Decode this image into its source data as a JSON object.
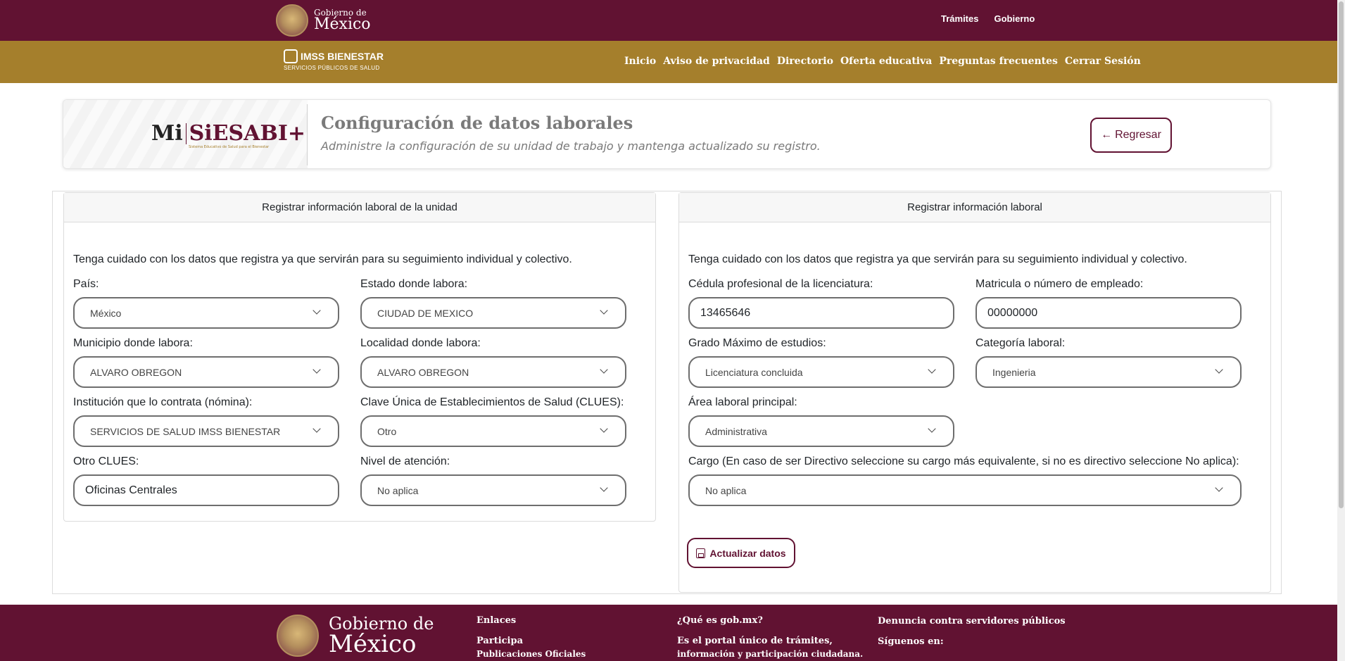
{
  "gov_header": {
    "logo_small": "Gobierno de",
    "logo_big": "México",
    "links": [
      "Trámites",
      "Gobierno"
    ]
  },
  "imss_header": {
    "logo_line1": "IMSS BIENESTAR",
    "logo_line2": "SERVICIOS PÚBLICOS DE SALUD",
    "nav": [
      "Inicio",
      "Aviso de privacidad",
      "Directorio",
      "Oferta educativa",
      "Preguntas frecuentes",
      "Cerrar Sesión"
    ]
  },
  "page_header": {
    "brand_mi": "Mi",
    "brand_name": "SiESABI+",
    "brand_sub": "Sistema Educativo de Salud para el Bienestar",
    "title": "Configuración de datos laborales",
    "subtitle": "Administre la configuración de su unidad de trabajo y mantenga actualizado su registro.",
    "back_label": "Regresar"
  },
  "left_panel": {
    "header": "Registrar información laboral de la unidad",
    "note": "Tenga cuidado con los datos que registra ya que servirán para su seguimiento individual y colectivo.",
    "fields": {
      "pais": {
        "label": "País:",
        "value": "México"
      },
      "estado": {
        "label": "Estado donde labora:",
        "value": "CIUDAD DE MEXICO"
      },
      "municipio": {
        "label": "Municipio donde labora:",
        "value": "ALVARO OBREGON"
      },
      "localidad": {
        "label": "Localidad donde labora:",
        "value": "ALVARO OBREGON"
      },
      "institucion": {
        "label": "Institución que lo contrata (nómina):",
        "value": "SERVICIOS DE SALUD IMSS BIENESTAR"
      },
      "clues": {
        "label": "Clave Única de Establecimientos de Salud (CLUES):",
        "value": "Otro"
      },
      "otro_clues": {
        "label": "Otro CLUES:",
        "value": "Oficinas Centrales"
      },
      "nivel": {
        "label": "Nivel de atención:",
        "value": "No aplica"
      }
    }
  },
  "right_panel": {
    "header": "Registrar información laboral",
    "note": "Tenga cuidado con los datos que registra ya que servirán para su seguimiento individual y colectivo.",
    "fields": {
      "cedula": {
        "label": "Cédula profesional de la licenciatura:",
        "value": "13465646"
      },
      "matricula": {
        "label": "Matricula o número de empleado:",
        "value": "00000000"
      },
      "grado": {
        "label": "Grado Máximo de estudios:",
        "value": "Licenciatura concluida"
      },
      "categoria": {
        "label": "Categoría laboral:",
        "value": "Ingenieria"
      },
      "area": {
        "label": "Área laboral principal:",
        "value": "Administrativa"
      },
      "cargo": {
        "label": "Cargo (En caso de ser Directivo seleccione su cargo más equivalente, si no es directivo seleccione No aplica):",
        "value": "No aplica"
      }
    },
    "update_label": "Actualizar datos"
  },
  "footer": {
    "logo_small": "Gobierno de",
    "logo_big": "México",
    "enlaces_title": "Enlaces",
    "enlaces": [
      "Participa",
      "Publicaciones Oficiales"
    ],
    "que_es_title": "¿Qué es gob.mx?",
    "que_es_text1": "Es el portal único de trámites,",
    "que_es_text2": "información y participación ciudadana.",
    "denuncia": "Denuncia contra servidores públicos",
    "siguenos": "Síguenos en:"
  },
  "colors": {
    "primary": "#611232",
    "gold": "#a57f2c"
  }
}
